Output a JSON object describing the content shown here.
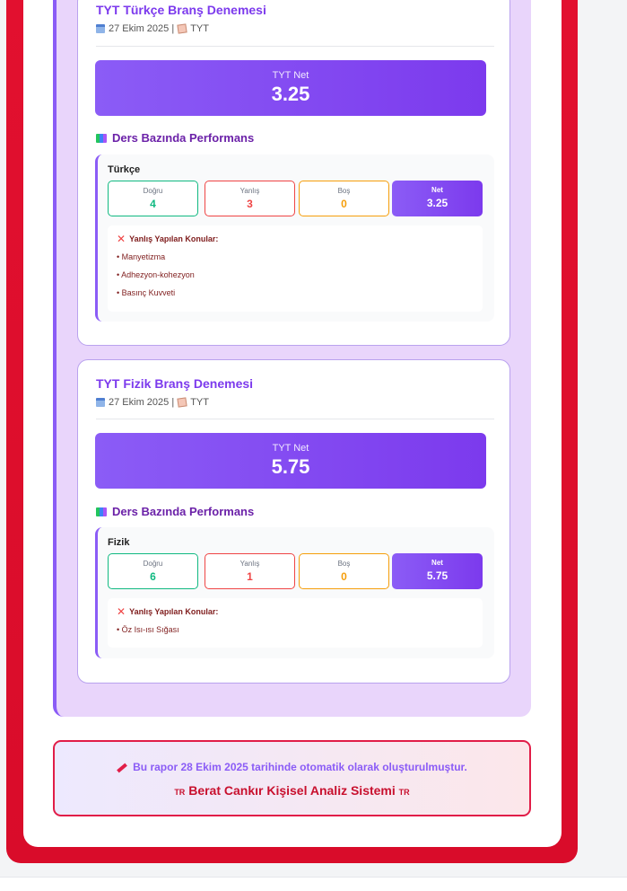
{
  "exams": [
    {
      "title": "TYT Türkçe Branş Denemesi",
      "date": "27 Ekim 2025 |",
      "type": "TYT",
      "net_label": "TYT Net",
      "net_value": "3.25",
      "perf_title": "Ders Bazında Performans",
      "subject": {
        "name": "Türkçe",
        "dogru_label": "Doğru",
        "dogru": "4",
        "yanlis_label": "Yanlış",
        "yanlis": "3",
        "bos_label": "Boş",
        "bos": "0",
        "net_label": "Net",
        "net": "3.25",
        "wrong_title": "Yanlış Yapılan Konular:",
        "wrong_topics": [
          "• Manyetizma",
          "• Adhezyon-kohezyon",
          "• Basınç Kuvveti"
        ]
      }
    },
    {
      "title": "TYT Fizik Branş Denemesi",
      "date": "27 Ekim 2025 |",
      "type": "TYT",
      "net_label": "TYT Net",
      "net_value": "5.75",
      "perf_title": "Ders Bazında Performans",
      "subject": {
        "name": "Fizik",
        "dogru_label": "Doğru",
        "dogru": "6",
        "yanlis_label": "Yanlış",
        "yanlis": "1",
        "bos_label": "Boş",
        "bos": "0",
        "net_label": "Net",
        "net": "5.75",
        "wrong_title": "Yanlış Yapılan Konular:",
        "wrong_topics": [
          "• Öz Isı-ısı Sığası"
        ]
      }
    }
  ],
  "footer": {
    "generated": "Bu rapor 28 Ekim 2025 tarihinde otomatik olarak oluşturulmuştur.",
    "flag_left": "TR",
    "system_name": "Berat Cankır Kişisel Analiz Sistemi",
    "flag_right": "TR"
  },
  "colors": {
    "frame": "#e2102f",
    "accent": "#7c3aed",
    "panel": "#e9d5fb",
    "dogru": "#10b981",
    "yanlis": "#ef4444",
    "bos": "#f59e0b"
  },
  "icons": [
    "calendar-icon",
    "memo-icon",
    "books-icon",
    "cross-mark-icon",
    "syringe-icon"
  ]
}
